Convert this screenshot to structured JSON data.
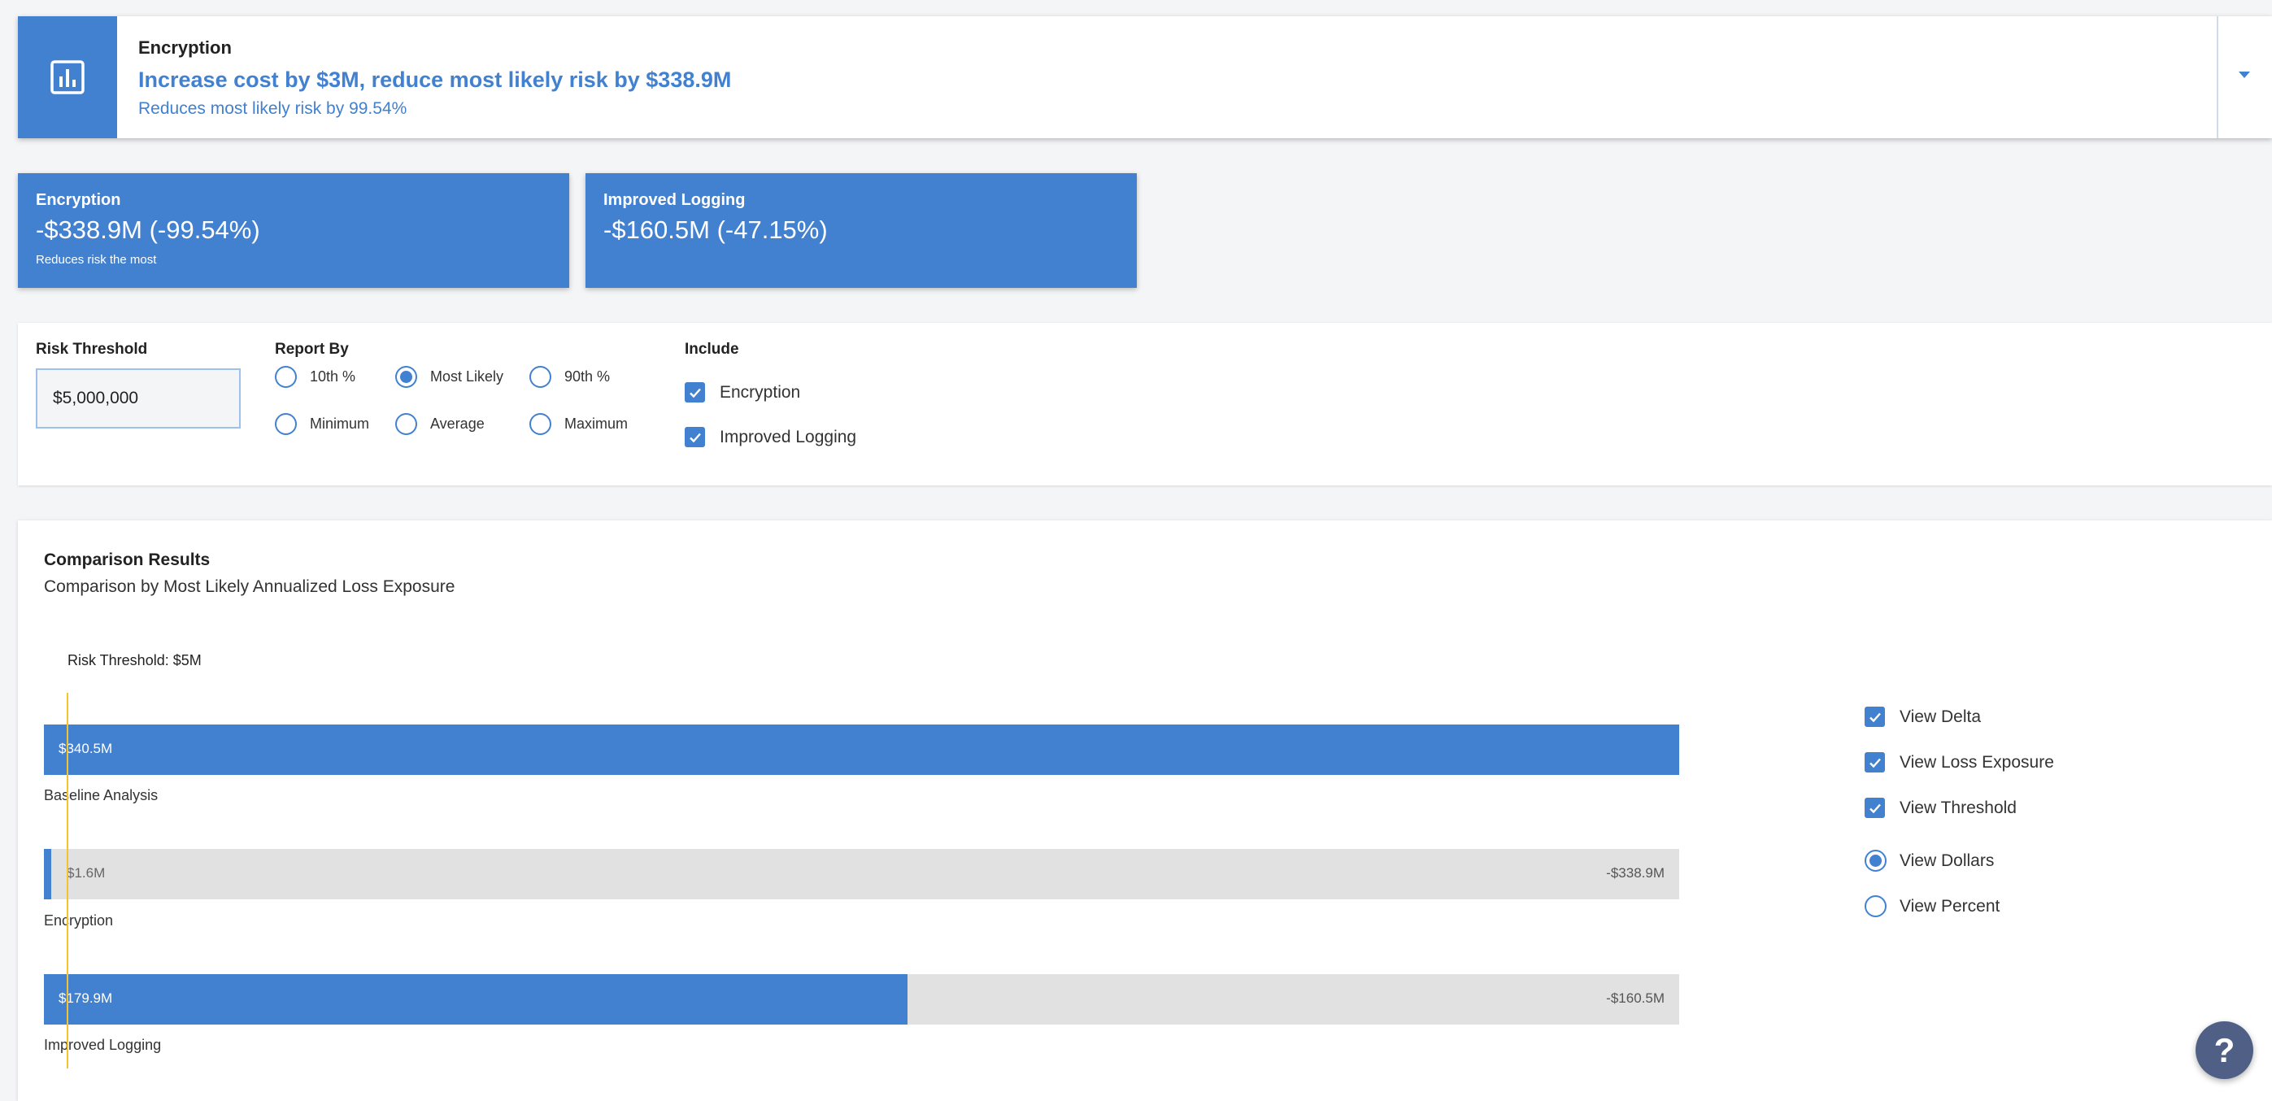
{
  "header": {
    "title": "Encryption",
    "headline": "Increase cost by $3M, reduce most likely risk by $338.9M",
    "subtitle": "Reduces most likely risk by 99.54%",
    "icon": "bar-chart-icon"
  },
  "cards": [
    {
      "title": "Encryption",
      "value": "-$338.9M (-99.54%)",
      "note": "Reduces risk the most"
    },
    {
      "title": "Improved Logging",
      "value": "-$160.5M (-47.15%)",
      "note": ""
    }
  ],
  "controls": {
    "threshold_label": "Risk Threshold",
    "threshold_value": "$5,000,000",
    "report_by_label": "Report By",
    "report_by_options": [
      {
        "label": "10th %",
        "selected": false
      },
      {
        "label": "Most Likely",
        "selected": true
      },
      {
        "label": "90th %",
        "selected": false
      },
      {
        "label": "Minimum",
        "selected": false
      },
      {
        "label": "Average",
        "selected": false
      },
      {
        "label": "Maximum",
        "selected": false
      }
    ],
    "include_label": "Include",
    "include_options": [
      {
        "label": "Encryption",
        "checked": true
      },
      {
        "label": "Improved Logging",
        "checked": true
      }
    ]
  },
  "comparison": {
    "title": "Comparison Results",
    "subtitle": "Comparison by Most Likely Annualized Loss Exposure",
    "threshold_label": "Risk Threshold: $5M",
    "bars": [
      {
        "name": "Baseline Analysis",
        "value_label": "$340.5M",
        "delta_label": "",
        "fill": 1.0
      },
      {
        "name": "Encryption",
        "value_label": "$1.6M",
        "delta_label": "-$338.9M",
        "fill": 0.0047
      },
      {
        "name": "Improved Logging",
        "value_label": "$179.9M",
        "delta_label": "-$160.5M",
        "fill": 0.5283
      }
    ],
    "view_options": [
      {
        "label": "View Delta",
        "checked": true
      },
      {
        "label": "View Loss Exposure",
        "checked": true
      },
      {
        "label": "View Threshold",
        "checked": true
      }
    ],
    "unit_options": [
      {
        "label": "View Dollars",
        "selected": true
      },
      {
        "label": "View Percent",
        "selected": false
      }
    ]
  },
  "help": {
    "label": "?"
  },
  "colors": {
    "accent": "#4280d0",
    "threshold": "#f4c430",
    "track": "#e1e1e1"
  }
}
